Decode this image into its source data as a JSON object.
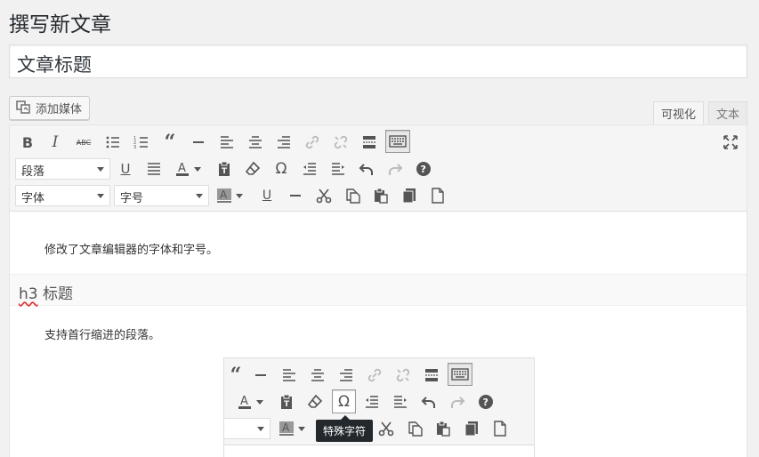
{
  "page": {
    "title": "撰写新文章"
  },
  "post": {
    "title_value": "文章标题"
  },
  "media": {
    "add_label": "添加媒体"
  },
  "tabs": {
    "visual": "可视化",
    "text": "文本"
  },
  "toolbar": {
    "format_select": "段落",
    "font_family_select": "字体",
    "font_size_select": "字号"
  },
  "content": {
    "paragraph1": "修改了文章编辑器的字体和字号。",
    "heading_tag": "h3",
    "heading_text": "标题",
    "paragraph2": "支持首行缩进的段落。"
  },
  "tooltip": {
    "text": "特殊字符"
  },
  "icons": [
    "bold-icon",
    "italic-icon",
    "strikethrough-icon",
    "bullet-list-icon",
    "numbered-list-icon",
    "blockquote-icon",
    "horizontal-rule-icon",
    "align-left-icon",
    "align-center-icon",
    "align-right-icon",
    "link-icon",
    "unlink-icon",
    "read-more-icon",
    "toolbar-toggle-icon",
    "fullscreen-icon",
    "underline-icon",
    "justify-icon",
    "text-color-icon",
    "paste-text-icon",
    "clear-format-icon",
    "special-char-icon",
    "outdent-icon",
    "indent-icon",
    "undo-icon",
    "redo-icon",
    "help-icon",
    "background-color-icon",
    "underline-alt-icon",
    "hr-alt-icon",
    "cut-icon",
    "copy-icon",
    "paste-icon",
    "paste-word-icon",
    "new-doc-icon"
  ]
}
